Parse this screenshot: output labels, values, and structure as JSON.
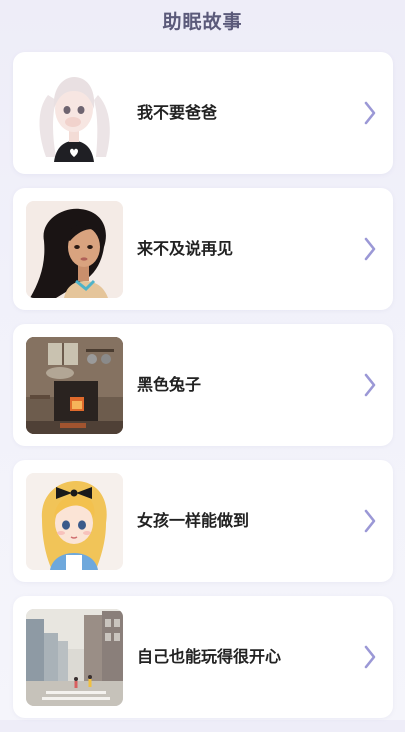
{
  "header": {
    "title": "助眠故事"
  },
  "stories": [
    {
      "title": "我不要爸爸",
      "thumbnail_icon": "girl-with-pigtails-illustration"
    },
    {
      "title": "来不及说再见",
      "thumbnail_icon": "girl-with-long-dark-hair-illustration"
    },
    {
      "title": "黑色兔子",
      "thumbnail_icon": "old-kitchen-with-stove-illustration"
    },
    {
      "title": "女孩一样能做到",
      "thumbnail_icon": "blonde-girl-with-bow-illustration"
    },
    {
      "title": "自己也能玩得很开心",
      "thumbnail_icon": "city-street-scene-illustration"
    }
  ],
  "colors": {
    "title_text": "#5b5a7a",
    "card_text": "#222222",
    "chevron": "#9b98d6",
    "background": "#eeedf8"
  },
  "icons": {
    "chevron": "chevron-right-icon"
  }
}
